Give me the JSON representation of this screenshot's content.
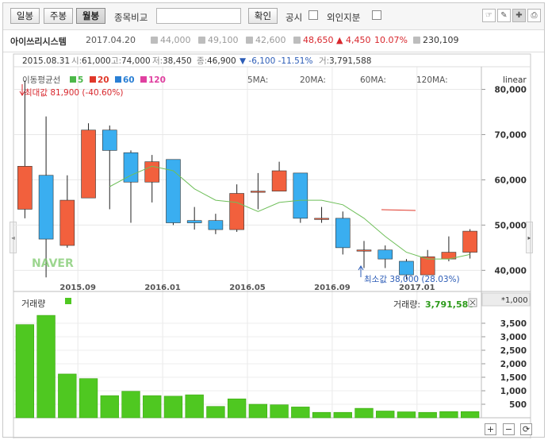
{
  "toolbar": {
    "period_day": "일봉",
    "period_week": "주봉",
    "period_month": "월봉",
    "compare_label": "종목비교",
    "compare_placeholder": "",
    "confirm": "확인",
    "disclosure": "공시",
    "foreign": "외인지분",
    "tools": [
      "cursor-icon",
      "pen-icon",
      "crosshair-icon",
      "print-icon"
    ]
  },
  "stock": {
    "name": "아이쓰리시스템",
    "date": "2017.04.20",
    "open": "44,000",
    "high": "49,100",
    "low": "42,600",
    "close": "48,650",
    "change": "▲ 4,450",
    "pct": "10.07%",
    "volume": "230,109"
  },
  "ohlc_line": {
    "date": "2015.08.31",
    "open_label": "시:",
    "open": "61,000",
    "high_label": "고:",
    "high": "74,000",
    "low_label": "저:",
    "low": "38,450",
    "close_label": "종:",
    "close": "46,900",
    "change": "▼ -6,100 -11.51%",
    "vol_label": "거:",
    "volume": "3,791,588"
  },
  "legend": {
    "title": "이동평균선",
    "ma": [
      {
        "label": "5",
        "color": "#4cb849"
      },
      {
        "label": "20",
        "color": "#e0382a"
      },
      {
        "label": "60",
        "color": "#2a7fd4"
      },
      {
        "label": "120",
        "color": "#e040a0"
      }
    ],
    "ma_headers": [
      "5MA:",
      "20MA:",
      "60MA:",
      "120MA:"
    ],
    "scale": "linear"
  },
  "annotations": {
    "max": "최대값 81,900 (-40.60%)",
    "min": "최소값 38,000 (28.03%)"
  },
  "watermark": "NAVER",
  "volume_panel": {
    "title": "거래량",
    "value_label": "거래량:",
    "value": "3,791,588",
    "unit": "*1,000"
  },
  "colors": {
    "up": "#f2603d",
    "down": "#3aaef0",
    "ma": "#6fbf5a",
    "volume": "#4fc821",
    "volume_edge": "#3aa80f"
  },
  "chart_data": [
    {
      "type": "candlestick",
      "x_tick_labels": [
        "2015.09",
        "2016.01",
        "2016.05",
        "2016.09",
        "2017.01"
      ],
      "y_ticks": [
        40000,
        50000,
        60000,
        70000,
        80000
      ],
      "y_tick_labels": [
        "40,000",
        "50,000",
        "60,000",
        "70,000",
        "80,000"
      ],
      "ylim": [
        35500,
        85000
      ],
      "candles": [
        {
          "o": 53500,
          "h": 81900,
          "l": 51500,
          "c": 63000
        },
        {
          "o": 61000,
          "h": 74000,
          "l": 38450,
          "c": 46900
        },
        {
          "o": 45500,
          "h": 61000,
          "l": 45000,
          "c": 55500
        },
        {
          "o": 56000,
          "h": 72500,
          "l": 56000,
          "c": 71000
        },
        {
          "o": 71000,
          "h": 72000,
          "l": 53500,
          "c": 66500
        },
        {
          "o": 66000,
          "h": 66500,
          "l": 50500,
          "c": 59500
        },
        {
          "o": 59500,
          "h": 65500,
          "l": 55000,
          "c": 64000
        },
        {
          "o": 64500,
          "h": 64500,
          "l": 50000,
          "c": 50500
        },
        {
          "o": 51000,
          "h": 54000,
          "l": 49000,
          "c": 50500
        },
        {
          "o": 51000,
          "h": 52500,
          "l": 48000,
          "c": 49000
        },
        {
          "o": 49000,
          "h": 59000,
          "l": 48500,
          "c": 57000
        },
        {
          "o": 57500,
          "h": 61500,
          "l": 53500,
          "c": 57500
        },
        {
          "o": 57500,
          "h": 64000,
          "l": 57500,
          "c": 62000
        },
        {
          "o": 61500,
          "h": 61500,
          "l": 50500,
          "c": 51500
        },
        {
          "o": 51500,
          "h": 54000,
          "l": 50500,
          "c": 51500
        },
        {
          "o": 51500,
          "h": 53000,
          "l": 43500,
          "c": 45000
        },
        {
          "o": 44500,
          "h": 46500,
          "l": 40500,
          "c": 44500
        },
        {
          "o": 44500,
          "h": 45500,
          "l": 40500,
          "c": 42500
        },
        {
          "o": 42000,
          "h": 42500,
          "l": 38000,
          "c": 39000
        },
        {
          "o": 39000,
          "h": 44500,
          "l": 39000,
          "c": 43000
        },
        {
          "o": 42500,
          "h": 47500,
          "l": 42000,
          "c": 44000
        },
        {
          "o": 44000,
          "h": 49100,
          "l": 42600,
          "c": 48650
        }
      ],
      "ma5": [
        null,
        null,
        null,
        null,
        58500,
        61000,
        63000,
        62000,
        58000,
        55500,
        55000,
        53000,
        55000,
        55500,
        55500,
        54500,
        51500,
        47500,
        44000,
        42500,
        42500,
        43500
      ]
    },
    {
      "type": "bar",
      "name": "거래량",
      "y_ticks": [
        500,
        1000,
        1500,
        2000,
        2500,
        3000,
        3500
      ],
      "y_tick_labels": [
        "500",
        "1,000",
        "1,500",
        "2,000",
        "2,500",
        "3,000",
        "3,500"
      ],
      "ylim": [
        0,
        4000
      ],
      "values": [
        3450,
        3791.588,
        1620,
        1450,
        820,
        980,
        820,
        800,
        850,
        420,
        700,
        500,
        480,
        400,
        200,
        200,
        350,
        250,
        220,
        200,
        230,
        230
      ]
    }
  ]
}
